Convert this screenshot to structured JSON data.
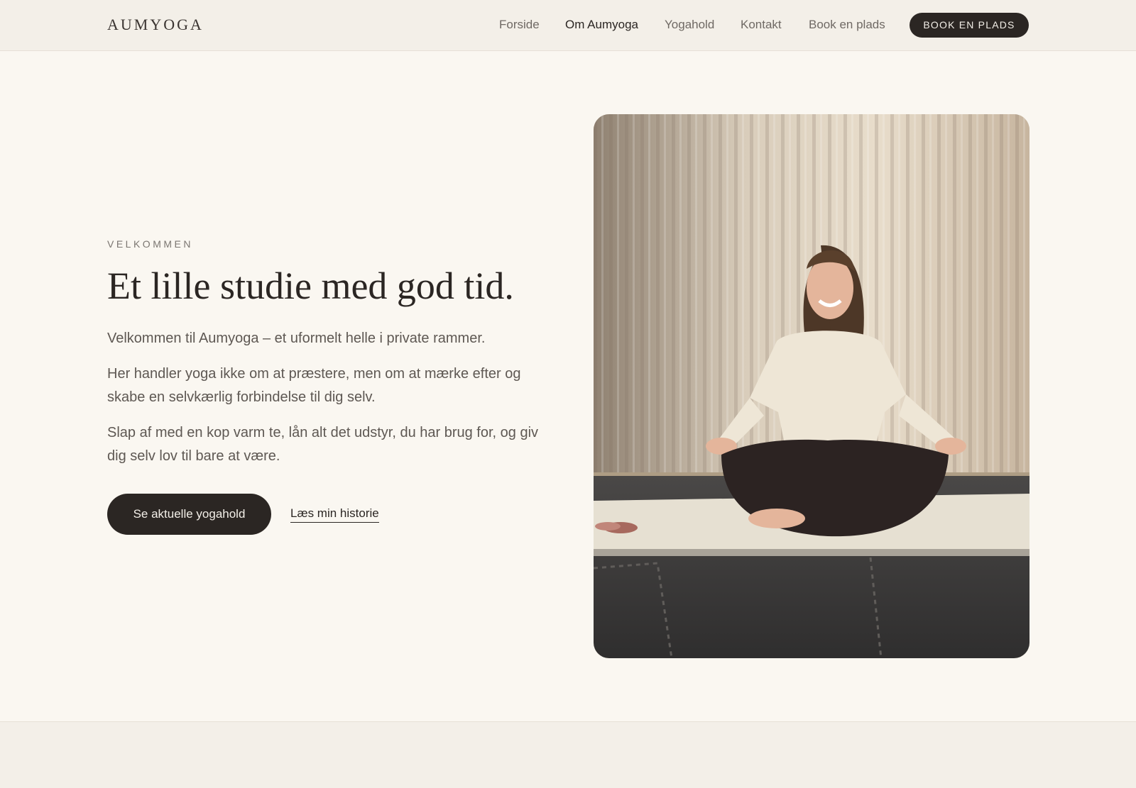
{
  "header": {
    "brand": "AUMYOGA",
    "nav": [
      {
        "label": "Forside",
        "active": false
      },
      {
        "label": "Om Aumyoga",
        "active": true
      },
      {
        "label": "Yogahold",
        "active": false
      },
      {
        "label": "Kontakt",
        "active": false
      },
      {
        "label": "Book en plads",
        "active": false
      }
    ],
    "book_button": "BOOK EN PLADS"
  },
  "hero": {
    "eyebrow": "VELKOMMEN",
    "headline": "Et lille studie med god tid.",
    "paragraphs": [
      "Velkommen til Aumyoga – et uformelt helle i private rammer.",
      "Her handler yoga ikke om at præstere, men om at mærke efter og skabe en selvkærlig forbindelse til dig selv.",
      "Slap af med en kop varm te, lån alt det udstyr, du har brug for, og giv dig selv lov til bare at være."
    ],
    "primary_cta": "Se aktuelle yogahold",
    "secondary_cta": "Læs min historie",
    "photo_icon": "woman-meditating-photo"
  },
  "colors": {
    "background": "#faf7f1",
    "header": "#f3efe8",
    "dark": "#2b2623",
    "muted_text": "#5e5853"
  }
}
